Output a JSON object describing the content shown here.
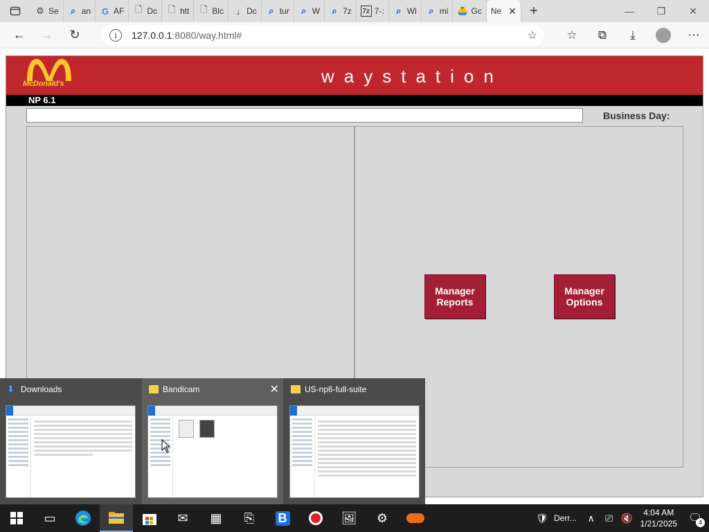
{
  "browser": {
    "tabs": [
      {
        "icon": "gear-icon",
        "label": "Se"
      },
      {
        "icon": "search-icon",
        "label": "an"
      },
      {
        "icon": "google-icon",
        "label": "AF"
      },
      {
        "icon": "document-icon",
        "label": "Dc"
      },
      {
        "icon": "document-icon",
        "label": "htt"
      },
      {
        "icon": "document-icon",
        "label": "Blc"
      },
      {
        "icon": "download-icon",
        "label": "Dc"
      },
      {
        "icon": "search-icon",
        "label": "tur"
      },
      {
        "icon": "search-icon",
        "label": "W"
      },
      {
        "icon": "search-icon",
        "label": "7z"
      },
      {
        "icon": "7zip-icon",
        "label": "7-:"
      },
      {
        "icon": "search-icon",
        "label": "Wl"
      },
      {
        "icon": "search-icon",
        "label": "mi"
      },
      {
        "icon": "drive-icon",
        "label": "Gc"
      },
      {
        "icon": "",
        "label": "Ne"
      }
    ],
    "new_tab": "+",
    "address": {
      "host": "127.0.0.1",
      "rest": ":8080/way.html#"
    }
  },
  "app": {
    "brand": "McDonald's",
    "title": "waystation",
    "version": "NP 6.1",
    "business_day_label": "Business Day:",
    "business_day_value": "",
    "message": "",
    "buttons": {
      "manager_reports": "Manager\nReports",
      "manager_options": "Manager\nOptions"
    },
    "colors": {
      "banner": "#c0272d",
      "button": "#a41f35",
      "arches": "#ffc72c"
    }
  },
  "taskbar_thumbnails": [
    {
      "title": "Downloads"
    },
    {
      "title": "Bandicam"
    },
    {
      "title": "US-np6-full-suite"
    }
  ],
  "taskbar": {
    "tray_label": "Derr...",
    "time": "4:04 AM",
    "date": "1/21/2025",
    "notifications": "4"
  }
}
